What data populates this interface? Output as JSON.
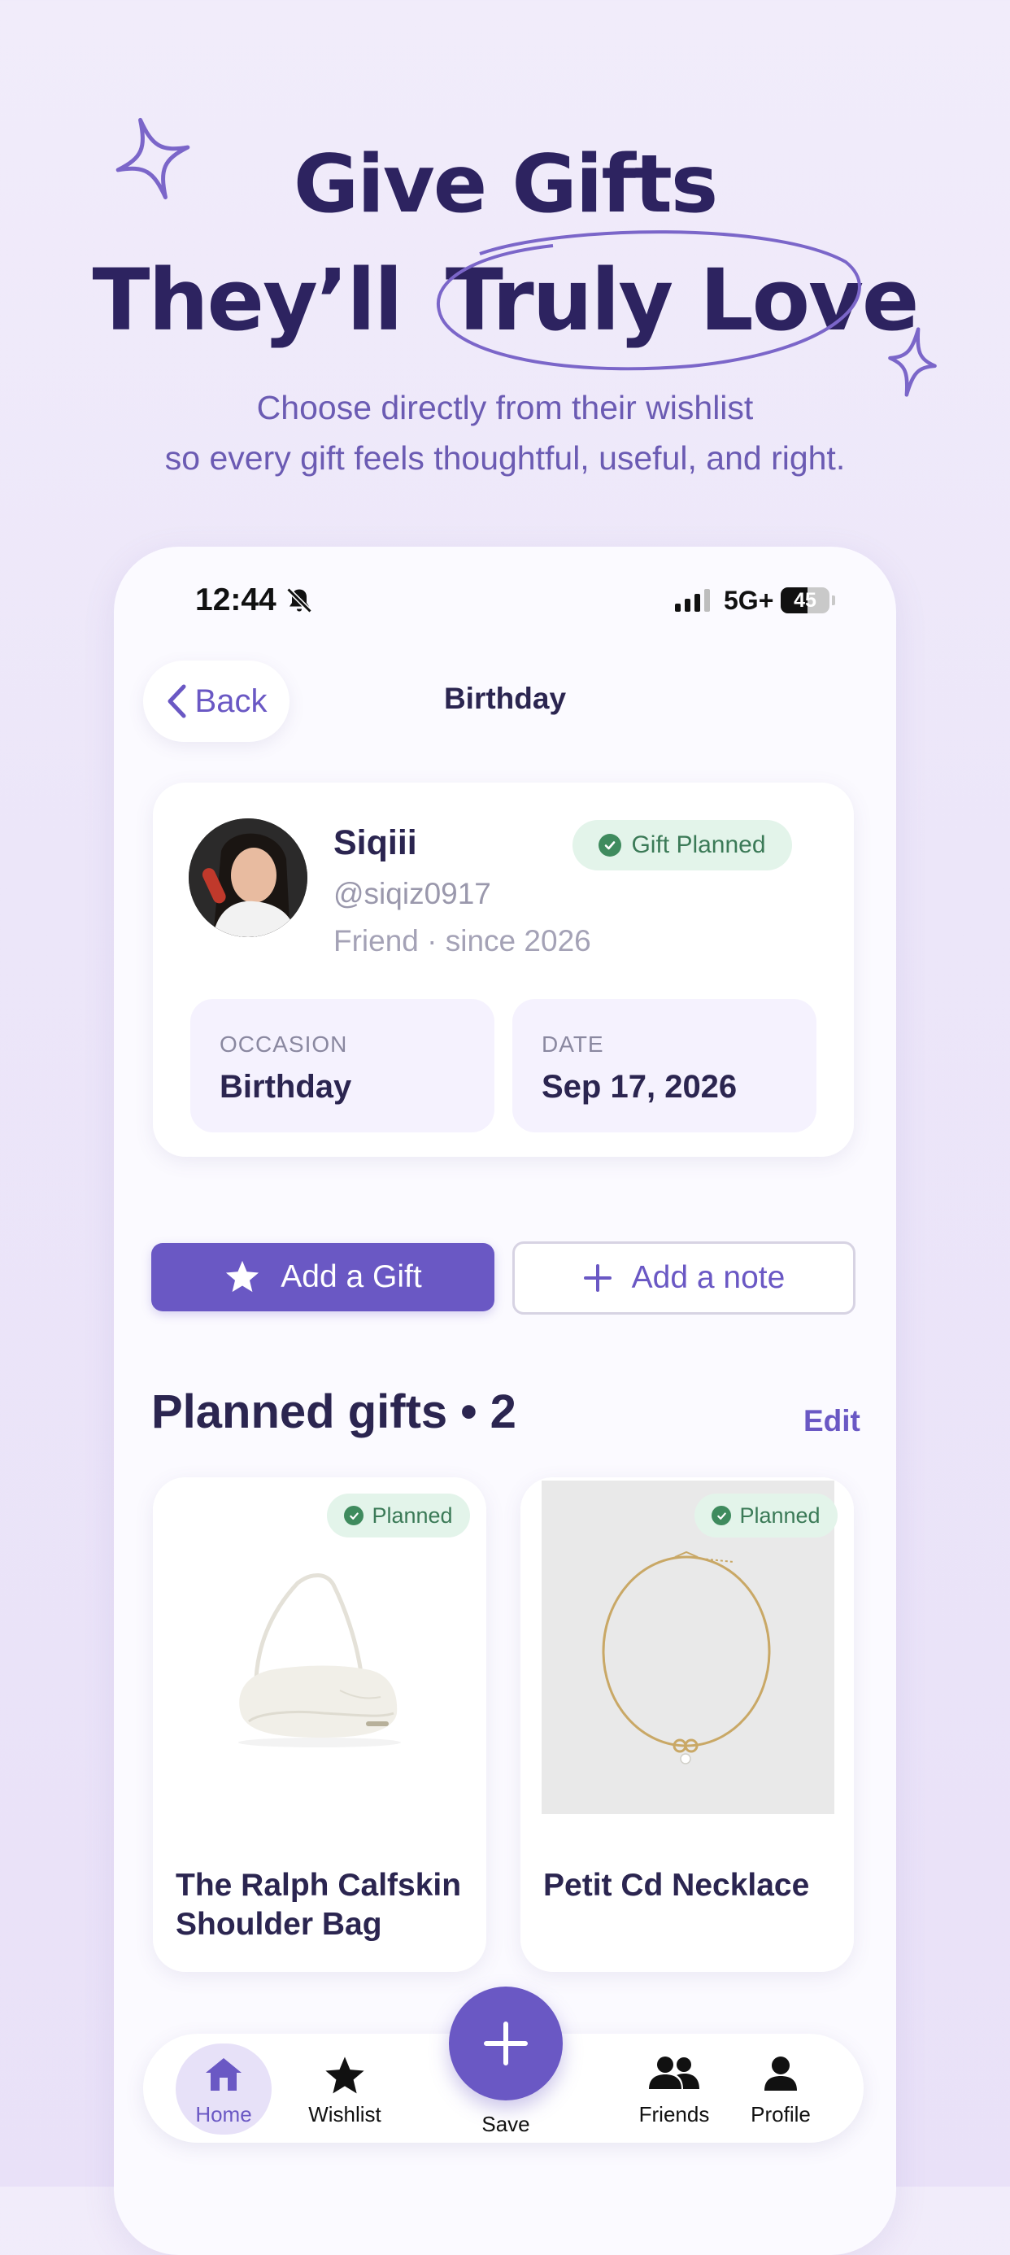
{
  "hero": {
    "title_line1": "Give Gifts",
    "title_line2_prefix": "They’ll",
    "title_line2_highlight": "Truly Love",
    "subtitle_line1": "Choose directly from their wishlist",
    "subtitle_line2": "so every gift feels thoughtful, useful, and right."
  },
  "status_bar": {
    "time": "12:44",
    "network": "5G+",
    "battery": "45"
  },
  "nav": {
    "back_label": "Back",
    "title": "Birthday"
  },
  "profile": {
    "name": "Siqiii",
    "handle": "@siqiz0917",
    "meta": "Friend · since 2026",
    "status_badge": "Gift Planned"
  },
  "info": {
    "occasion_label": "OCCASION",
    "occasion_value": "Birthday",
    "date_label": "DATE",
    "date_value": "Sep 17, 2026"
  },
  "actions": {
    "add_gift": "Add a Gift",
    "add_note": "Add a note"
  },
  "planned": {
    "title": "Planned gifts • 2",
    "edit": "Edit",
    "gifts": [
      {
        "name": "The Ralph Calfskin Shoulder Bag",
        "badge": "Planned"
      },
      {
        "name": "Petit Cd Necklace",
        "badge": "Planned"
      }
    ]
  },
  "tabbar": {
    "home": "Home",
    "wishlist": "Wishlist",
    "save": "Save",
    "friends": "Friends",
    "profile": "Profile"
  },
  "colors": {
    "accent": "#6a58c4",
    "heading": "#2d2360",
    "success_bg": "#e3f4ea",
    "success_text": "#3b7a57"
  }
}
